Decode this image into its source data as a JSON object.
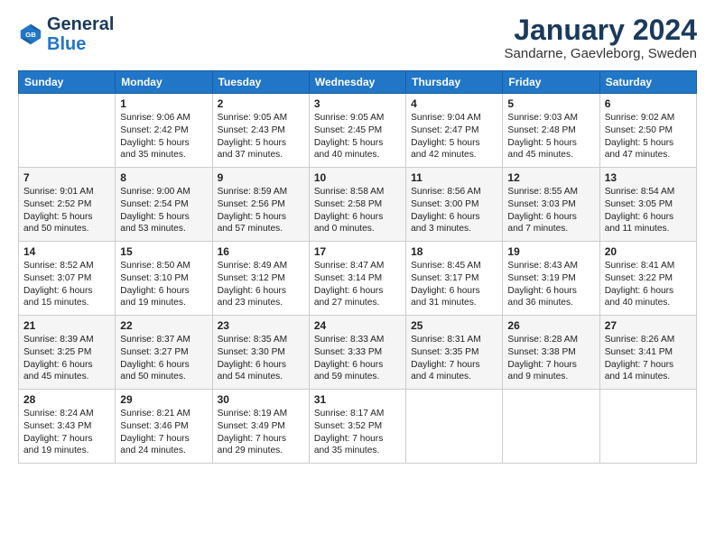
{
  "logo": {
    "line1": "General",
    "line2": "Blue"
  },
  "title": "January 2024",
  "subtitle": "Sandarne, Gaevleborg, Sweden",
  "days_header": [
    "Sunday",
    "Monday",
    "Tuesday",
    "Wednesday",
    "Thursday",
    "Friday",
    "Saturday"
  ],
  "weeks": [
    [
      {
        "day": "",
        "info": ""
      },
      {
        "day": "1",
        "info": "Sunrise: 9:06 AM\nSunset: 2:42 PM\nDaylight: 5 hours\nand 35 minutes."
      },
      {
        "day": "2",
        "info": "Sunrise: 9:05 AM\nSunset: 2:43 PM\nDaylight: 5 hours\nand 37 minutes."
      },
      {
        "day": "3",
        "info": "Sunrise: 9:05 AM\nSunset: 2:45 PM\nDaylight: 5 hours\nand 40 minutes."
      },
      {
        "day": "4",
        "info": "Sunrise: 9:04 AM\nSunset: 2:47 PM\nDaylight: 5 hours\nand 42 minutes."
      },
      {
        "day": "5",
        "info": "Sunrise: 9:03 AM\nSunset: 2:48 PM\nDaylight: 5 hours\nand 45 minutes."
      },
      {
        "day": "6",
        "info": "Sunrise: 9:02 AM\nSunset: 2:50 PM\nDaylight: 5 hours\nand 47 minutes."
      }
    ],
    [
      {
        "day": "7",
        "info": "Sunrise: 9:01 AM\nSunset: 2:52 PM\nDaylight: 5 hours\nand 50 minutes."
      },
      {
        "day": "8",
        "info": "Sunrise: 9:00 AM\nSunset: 2:54 PM\nDaylight: 5 hours\nand 53 minutes."
      },
      {
        "day": "9",
        "info": "Sunrise: 8:59 AM\nSunset: 2:56 PM\nDaylight: 5 hours\nand 57 minutes."
      },
      {
        "day": "10",
        "info": "Sunrise: 8:58 AM\nSunset: 2:58 PM\nDaylight: 6 hours\nand 0 minutes."
      },
      {
        "day": "11",
        "info": "Sunrise: 8:56 AM\nSunset: 3:00 PM\nDaylight: 6 hours\nand 3 minutes."
      },
      {
        "day": "12",
        "info": "Sunrise: 8:55 AM\nSunset: 3:03 PM\nDaylight: 6 hours\nand 7 minutes."
      },
      {
        "day": "13",
        "info": "Sunrise: 8:54 AM\nSunset: 3:05 PM\nDaylight: 6 hours\nand 11 minutes."
      }
    ],
    [
      {
        "day": "14",
        "info": "Sunrise: 8:52 AM\nSunset: 3:07 PM\nDaylight: 6 hours\nand 15 minutes."
      },
      {
        "day": "15",
        "info": "Sunrise: 8:50 AM\nSunset: 3:10 PM\nDaylight: 6 hours\nand 19 minutes."
      },
      {
        "day": "16",
        "info": "Sunrise: 8:49 AM\nSunset: 3:12 PM\nDaylight: 6 hours\nand 23 minutes."
      },
      {
        "day": "17",
        "info": "Sunrise: 8:47 AM\nSunset: 3:14 PM\nDaylight: 6 hours\nand 27 minutes."
      },
      {
        "day": "18",
        "info": "Sunrise: 8:45 AM\nSunset: 3:17 PM\nDaylight: 6 hours\nand 31 minutes."
      },
      {
        "day": "19",
        "info": "Sunrise: 8:43 AM\nSunset: 3:19 PM\nDaylight: 6 hours\nand 36 minutes."
      },
      {
        "day": "20",
        "info": "Sunrise: 8:41 AM\nSunset: 3:22 PM\nDaylight: 6 hours\nand 40 minutes."
      }
    ],
    [
      {
        "day": "21",
        "info": "Sunrise: 8:39 AM\nSunset: 3:25 PM\nDaylight: 6 hours\nand 45 minutes."
      },
      {
        "day": "22",
        "info": "Sunrise: 8:37 AM\nSunset: 3:27 PM\nDaylight: 6 hours\nand 50 minutes."
      },
      {
        "day": "23",
        "info": "Sunrise: 8:35 AM\nSunset: 3:30 PM\nDaylight: 6 hours\nand 54 minutes."
      },
      {
        "day": "24",
        "info": "Sunrise: 8:33 AM\nSunset: 3:33 PM\nDaylight: 6 hours\nand 59 minutes."
      },
      {
        "day": "25",
        "info": "Sunrise: 8:31 AM\nSunset: 3:35 PM\nDaylight: 7 hours\nand 4 minutes."
      },
      {
        "day": "26",
        "info": "Sunrise: 8:28 AM\nSunset: 3:38 PM\nDaylight: 7 hours\nand 9 minutes."
      },
      {
        "day": "27",
        "info": "Sunrise: 8:26 AM\nSunset: 3:41 PM\nDaylight: 7 hours\nand 14 minutes."
      }
    ],
    [
      {
        "day": "28",
        "info": "Sunrise: 8:24 AM\nSunset: 3:43 PM\nDaylight: 7 hours\nand 19 minutes."
      },
      {
        "day": "29",
        "info": "Sunrise: 8:21 AM\nSunset: 3:46 PM\nDaylight: 7 hours\nand 24 minutes."
      },
      {
        "day": "30",
        "info": "Sunrise: 8:19 AM\nSunset: 3:49 PM\nDaylight: 7 hours\nand 29 minutes."
      },
      {
        "day": "31",
        "info": "Sunrise: 8:17 AM\nSunset: 3:52 PM\nDaylight: 7 hours\nand 35 minutes."
      },
      {
        "day": "",
        "info": ""
      },
      {
        "day": "",
        "info": ""
      },
      {
        "day": "",
        "info": ""
      }
    ]
  ]
}
